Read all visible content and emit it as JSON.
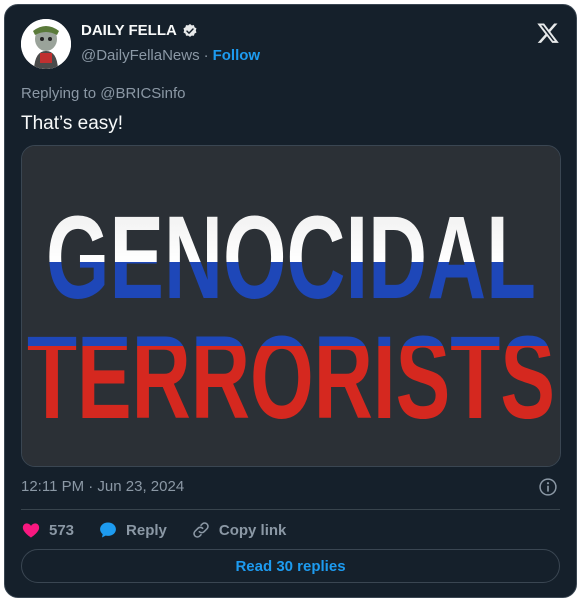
{
  "author": {
    "display_name": "DAILY FELLA",
    "handle": "@DailyFellaNews",
    "separator": "·",
    "follow_label": "Follow"
  },
  "tweet": {
    "reply_to": "Replying to @BRICSinfo",
    "text": "That’s easy!",
    "timestamp": "12:11 PM · Jun 23, 2024"
  },
  "media": {
    "line1": "GENOCIDAL",
    "line2": "TERRORISTS",
    "flag_colors": {
      "white": "#f4f4f4",
      "blue": "#1e47b8",
      "red": "#d5281f"
    }
  },
  "actions": {
    "like_count": "573",
    "reply_label": "Reply",
    "copy_label": "Copy link"
  },
  "footer": {
    "read_replies_label": "Read 30 replies"
  },
  "colors": {
    "background": "#15202b",
    "accent": "#1d9bf0",
    "like": "#f91880",
    "muted": "#8b98a5"
  }
}
